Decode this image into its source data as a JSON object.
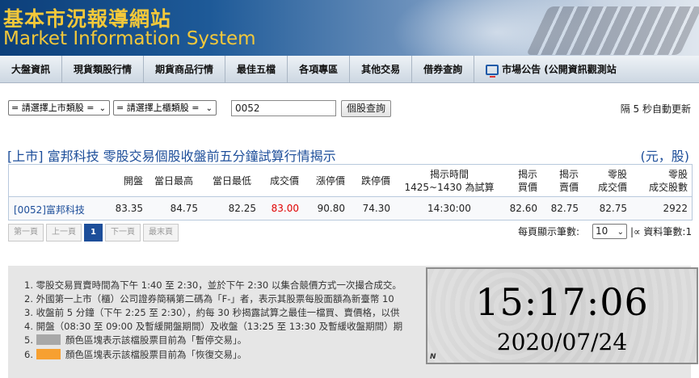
{
  "header": {
    "title_zh": "基本市況報導網站",
    "title_en": "Market Information System"
  },
  "nav": {
    "items": [
      "大盤資訊",
      "現貨類股行情",
      "期貨商品行情",
      "最佳五檔",
      "各項專區",
      "其他交易",
      "借券查詢"
    ],
    "announcement": "市場公告 (公開資訊觀測站"
  },
  "controls": {
    "listed_select": "= 請選擇上市類股 =",
    "otc_select": "= 請選擇上櫃類股 =",
    "stock_code": "0052",
    "query_button": "個股查詢",
    "auto_update": "隔 5 秒自動更新"
  },
  "section": {
    "title": "[上市] 富邦科技 零股交易個股收盤前五分鐘試算行情揭示",
    "unit": "(元，股)"
  },
  "table": {
    "headers": {
      "open": "開盤",
      "high": "當日最高",
      "low": "當日最低",
      "last": "成交價",
      "limit_up": "漲停價",
      "limit_down": "跌停價",
      "time_1": "揭示時間",
      "time_2": "1425~1430 為試算",
      "bid_1": "揭示",
      "bid_2": "買價",
      "ask_1": "揭示",
      "ask_2": "賣價",
      "odd_price_1": "零股",
      "odd_price_2": "成交價",
      "odd_volume_1": "零股",
      "odd_volume_2": "成交股數"
    },
    "row": {
      "name": "[0052]富邦科技",
      "open": "83.35",
      "high": "84.75",
      "low": "82.25",
      "last": "83.00",
      "limit_up": "90.80",
      "limit_down": "74.30",
      "time": "14:30:00",
      "bid": "82.60",
      "ask": "82.75",
      "odd_price": "82.75",
      "odd_volume": "2922"
    }
  },
  "pager": {
    "first": "第一頁",
    "prev": "上一頁",
    "current": "1",
    "next": "下一頁",
    "last": "最末頁",
    "per_page_label": "每頁顯示筆數:",
    "per_page_value": "10",
    "totals": "|∝ 資料筆數:1"
  },
  "notes": {
    "n1": "1. 零股交易買賣時間為下午 1:40 至 2:30，並於下午 2:30 以集合競價方式一次撮合成交。",
    "n2": "2. 外國第一上市（櫃）公司證券簡稱第二碼為「F-」者，表示其股票每股面額為新臺幣 10",
    "n3": "3. 收盤前 5 分鐘（下午 2:25 至 2:30），約每 30 秒揭露試算之最佳一檔買、賣價格，以供",
    "n4": "4. 開盤（08:30 至 09:00 及暫緩開盤期間）及收盤（13:25 至 13:30 及暫緩收盤期間）期",
    "n5_num": "5.",
    "n5_text": "顏色區塊表示該檔股票目前為「暫停交易」。",
    "n6_num": "6.",
    "n6_text": "顏色區塊表示該檔股票目前為「恢復交易」。",
    "halt_color": "#a8a8a8",
    "resume_color": "#f7a031"
  },
  "clock": {
    "time": "15:17:06",
    "date": "2020/07/24",
    "corner": "N"
  }
}
